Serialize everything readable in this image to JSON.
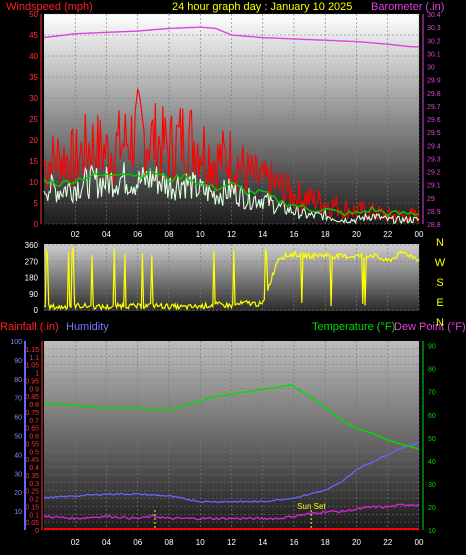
{
  "chart_data": [
    {
      "type": "line",
      "title": "24 hour graph day : January 10 2025",
      "ylabel_left": "Windspeed (mph)",
      "ylabel_right": "Barometer (.in)",
      "x_ticks": [
        "02",
        "04",
        "06",
        "08",
        "10",
        "12",
        "14",
        "16",
        "18",
        "20",
        "22",
        "00"
      ],
      "ylim_left": [
        0,
        50
      ],
      "y_ticks_left": [
        "0",
        "5",
        "10",
        "15",
        "20",
        "25",
        "30",
        "35",
        "40",
        "45",
        "50"
      ],
      "ylim_right": [
        28.8,
        30.4
      ],
      "y_ticks_right": [
        "28.8",
        "28.9",
        "29",
        "29.1",
        "29.2",
        "29.3",
        "29.4",
        "29.5",
        "29.6",
        "29.7",
        "29.8",
        "29.9",
        "30",
        "30.1",
        "30.2",
        "30.3",
        "30.4"
      ],
      "colors": {
        "wind_gust": "#ff0000",
        "wind_avg": "#ddffdd",
        "wind_10min": "#00cc00",
        "barometer": "#dd44dd"
      },
      "series": [
        {
          "name": "",
          "axis": "right",
          "x": [
            0,
            2,
            4,
            6,
            8,
            10,
            11,
            12,
            14,
            16,
            18,
            20,
            22,
            23.5
          ],
          "values": [
            30.22,
            30.25,
            30.26,
            30.27,
            30.29,
            30.3,
            30.29,
            30.24,
            30.22,
            30.21,
            30.2,
            30.19,
            30.17,
            30.15
          ]
        },
        {
          "name": "",
          "axis": "left",
          "x": [
            0,
            1,
            2,
            3,
            4,
            5,
            6,
            7,
            8,
            9,
            10,
            11,
            12,
            13,
            14,
            15,
            16,
            17,
            18,
            19,
            20,
            21,
            22,
            23,
            24
          ],
          "values": [
            14,
            16,
            15,
            19,
            17,
            19,
            22,
            20,
            18,
            21,
            19,
            15,
            16,
            12,
            10,
            9,
            7,
            6,
            5,
            4,
            3,
            3,
            2,
            2,
            2
          ]
        },
        {
          "name": "",
          "axis": "left",
          "x": [
            0,
            1,
            2,
            3,
            4,
            5,
            6,
            7,
            8,
            9,
            10,
            11,
            12,
            13,
            14,
            15,
            16,
            17,
            18,
            19,
            20,
            21,
            22,
            23,
            24
          ],
          "values": [
            9,
            8,
            9,
            10,
            10,
            11,
            10,
            11,
            9,
            10,
            8,
            7,
            8,
            6,
            6,
            4,
            3,
            2,
            2,
            1,
            1,
            2,
            1,
            1,
            1
          ]
        },
        {
          "name": "",
          "axis": "left",
          "x": [
            0,
            1,
            2,
            3,
            4,
            5,
            6,
            7,
            8,
            9,
            10,
            11,
            12,
            13,
            14,
            15,
            16,
            17,
            18,
            19,
            20,
            21,
            22,
            23,
            24
          ],
          "values": [
            5,
            5,
            6,
            6,
            7,
            7,
            7,
            6,
            6,
            7,
            6,
            5,
            5,
            4,
            3,
            2,
            1,
            1,
            0,
            0,
            0,
            1,
            0,
            0,
            0
          ]
        }
      ]
    },
    {
      "type": "line",
      "ylim": [
        0,
        360
      ],
      "y_ticks": [
        "0",
        "90",
        "180",
        "270",
        "360"
      ],
      "x_ticks": [
        "02",
        "04",
        "06",
        "08",
        "10",
        "12",
        "14",
        "16",
        "18",
        "20",
        "22",
        "00"
      ],
      "compass_labels": [
        "N",
        "W",
        "S",
        "E",
        "N"
      ],
      "color": "#ffff00",
      "series": [
        {
          "name": "",
          "x": [
            0,
            1,
            2,
            3,
            4,
            5,
            6,
            7,
            8,
            9,
            10,
            11,
            12,
            13,
            14,
            15,
            16,
            17,
            18,
            19,
            20,
            21,
            22,
            23,
            24
          ],
          "values": [
            20,
            15,
            25,
            20,
            15,
            25,
            20,
            25,
            20,
            15,
            20,
            30,
            25,
            40,
            30,
            290,
            310,
            300,
            305,
            295,
            300,
            305,
            270,
            320,
            280
          ]
        }
      ]
    },
    {
      "type": "line",
      "ylabel_left_1": "Rainfall (.in)",
      "ylabel_left_2": "Humidity",
      "ylabel_right_1": "Temperature (°F)",
      "ylabel_right_2": "Dew Point (°F)",
      "annotation": "Sun Set",
      "x_ticks": [
        "02",
        "04",
        "06",
        "08",
        "10",
        "12",
        "14",
        "16",
        "18",
        "20",
        "22",
        "00"
      ],
      "ylim_humidity": [
        0,
        100
      ],
      "y_ticks_humidity": [
        "10",
        "20",
        "30",
        "40",
        "50",
        "60",
        "70",
        "80",
        "90",
        "100"
      ],
      "ylim_rain": [
        0,
        1.2
      ],
      "y_ticks_rain": [
        "0",
        "0.05",
        "0.1",
        "0.15",
        "0.2",
        "0.25",
        "0.3",
        "0.35",
        "0.4",
        "0.45",
        "0.5",
        "0.55",
        "0.6",
        "0.65",
        "0.7",
        "0.75",
        "0.8",
        "0.85",
        "0.9",
        "0.95",
        "1",
        "1.05",
        "1.1",
        "1.15"
      ],
      "ylim_temp": [
        10,
        92
      ],
      "y_ticks_temp": [
        "10",
        "20",
        "30",
        "40",
        "50",
        "60",
        "70",
        "80",
        "90"
      ],
      "colors": {
        "humidity": "#6666ff",
        "temperature": "#00dd00",
        "dewpoint": "#dd22dd",
        "rain": "#ff0000",
        "sunset": "#ffff00"
      },
      "sunrise_hour": 7.1,
      "sunset_hour": 17.1,
      "series": [
        {
          "name": "Temperature (°F)",
          "axis": "temp",
          "x": [
            0,
            2,
            4,
            6,
            7,
            8,
            9,
            10,
            11,
            12,
            13,
            14,
            15,
            15.8,
            16.5,
            17,
            18,
            19,
            20,
            21,
            22,
            23,
            24
          ],
          "values": [
            65,
            64,
            63,
            63,
            62,
            62,
            64,
            66,
            68,
            69,
            70,
            71,
            72,
            73,
            70,
            68,
            63,
            58,
            54,
            52,
            49,
            47,
            45
          ]
        },
        {
          "name": "Dew Point (°F)",
          "axis": "temp",
          "x": [
            0,
            2,
            4,
            6,
            7,
            8,
            10,
            12,
            14,
            15,
            16,
            17,
            18,
            19,
            20,
            21,
            22,
            23,
            24
          ],
          "values": [
            16,
            15,
            16,
            15,
            16,
            15,
            15,
            15,
            15,
            15,
            16,
            17,
            18,
            18,
            19,
            20,
            20,
            21,
            21
          ]
        },
        {
          "name": "Humidity",
          "axis": "humidity",
          "x": [
            0,
            2,
            4,
            6,
            8,
            10,
            12,
            13,
            14,
            15,
            16,
            17,
            18,
            19,
            20,
            21,
            22,
            23,
            24
          ],
          "values": [
            17,
            18,
            19,
            19,
            18,
            15,
            15,
            15,
            15,
            16,
            17,
            19,
            21,
            25,
            32,
            36,
            40,
            44,
            46
          ]
        },
        {
          "name": "Rainfall (.in)",
          "axis": "rain",
          "x": [
            0,
            24
          ],
          "values": [
            0,
            0
          ]
        }
      ]
    }
  ]
}
